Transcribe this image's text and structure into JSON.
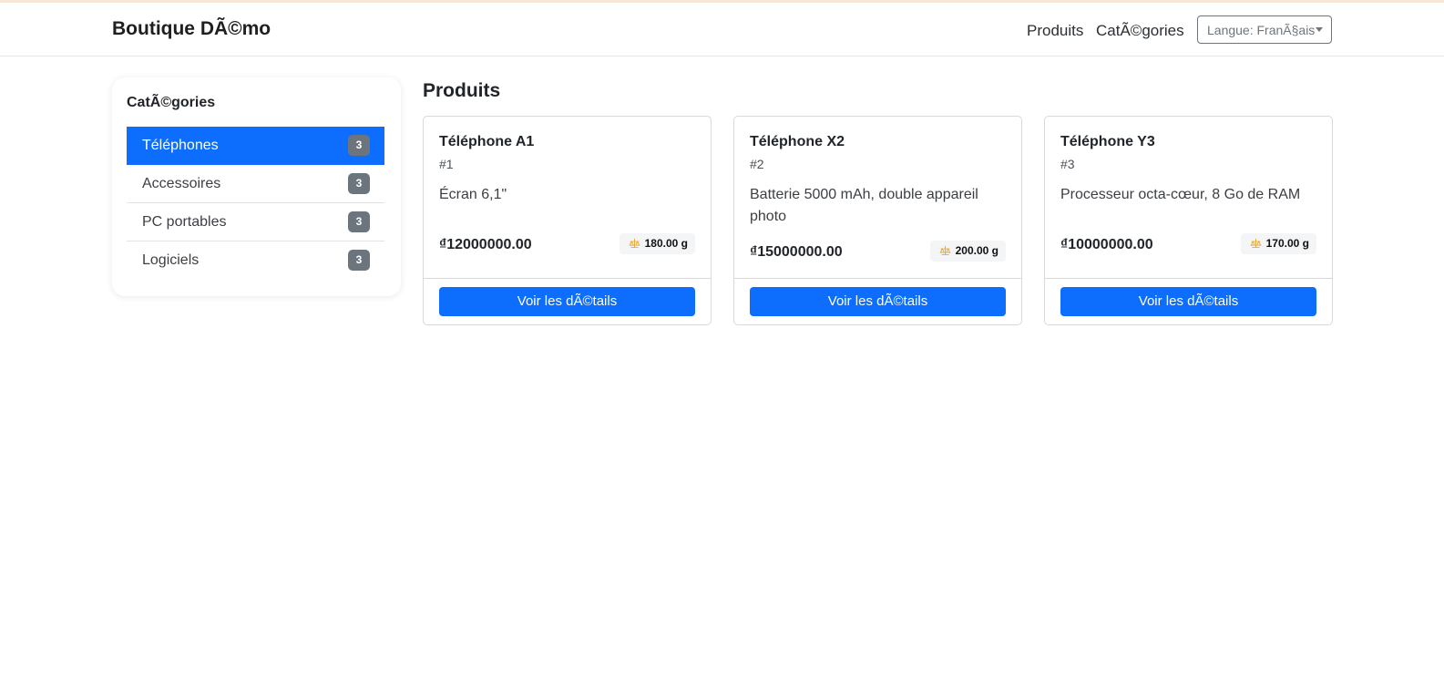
{
  "navbar": {
    "brand": "Boutique DÃ©mo",
    "links": [
      "Produits",
      "CatÃ©gories"
    ],
    "language_select": "Langue: FranÃ§ais"
  },
  "sidebar": {
    "title": "CatÃ©gories",
    "items": [
      {
        "label": "Téléphones",
        "count": "3",
        "active": true
      },
      {
        "label": "Accessoires",
        "count": "3",
        "active": false
      },
      {
        "label": "PC portables",
        "count": "3",
        "active": false
      },
      {
        "label": "Logiciels",
        "count": "3",
        "active": false
      }
    ]
  },
  "main": {
    "heading": "Produits",
    "products": [
      {
        "name": "Téléphone A1",
        "id": "#1",
        "description": "Écran 6,1\"",
        "price": "₫12000000.00",
        "weight": "180.00 g",
        "button": "Voir les dÃ©tails"
      },
      {
        "name": "Téléphone X2",
        "id": "#2",
        "description": "Batterie 5000 mAh, double appareil photo",
        "price": "₫15000000.00",
        "weight": "200.00 g",
        "button": "Voir les dÃ©tails"
      },
      {
        "name": "Téléphone Y3",
        "id": "#3",
        "description": "Processeur octa-cœur, 8 Go de RAM",
        "price": "₫10000000.00",
        "weight": "170.00 g",
        "button": "Voir les dÃ©tails"
      }
    ]
  },
  "icons": {
    "weight": "scale-icon"
  },
  "colors": {
    "primary": "#0d6efd",
    "badge": "#6c757d",
    "scale_icon": "#e9a93a"
  }
}
